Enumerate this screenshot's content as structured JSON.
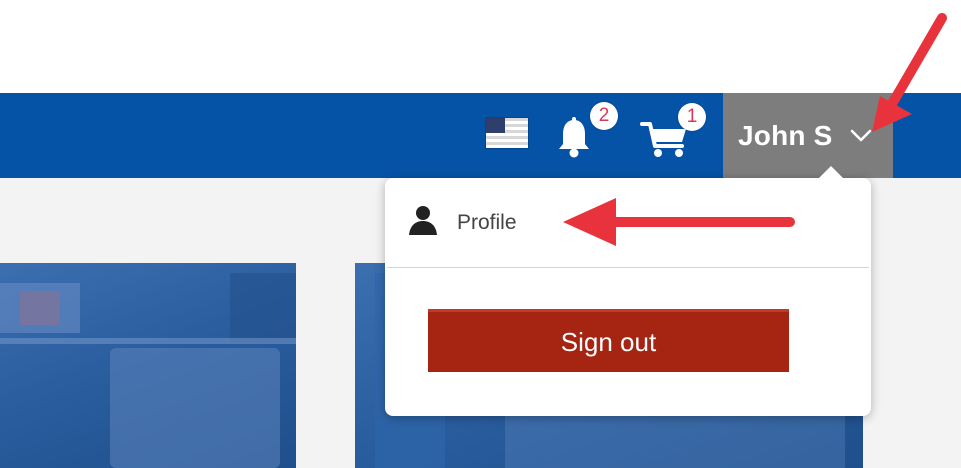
{
  "header": {
    "language_icon": "us-flag-icon",
    "notifications": {
      "icon": "bell-icon",
      "count": "2"
    },
    "cart": {
      "icon": "cart-icon",
      "count": "1"
    },
    "user": {
      "name": "John S",
      "icon": "chevron-down-icon"
    }
  },
  "user_dropdown": {
    "profile": {
      "icon": "person-icon",
      "label": "Profile"
    },
    "sign_out_label": "Sign out"
  },
  "colors": {
    "header_bar": "#0553a7",
    "user_menu": "#7d7d7d",
    "sign_out_button": "#a52512",
    "badge_text": "#d63a5a",
    "annotation_arrow": "#e8333c"
  }
}
